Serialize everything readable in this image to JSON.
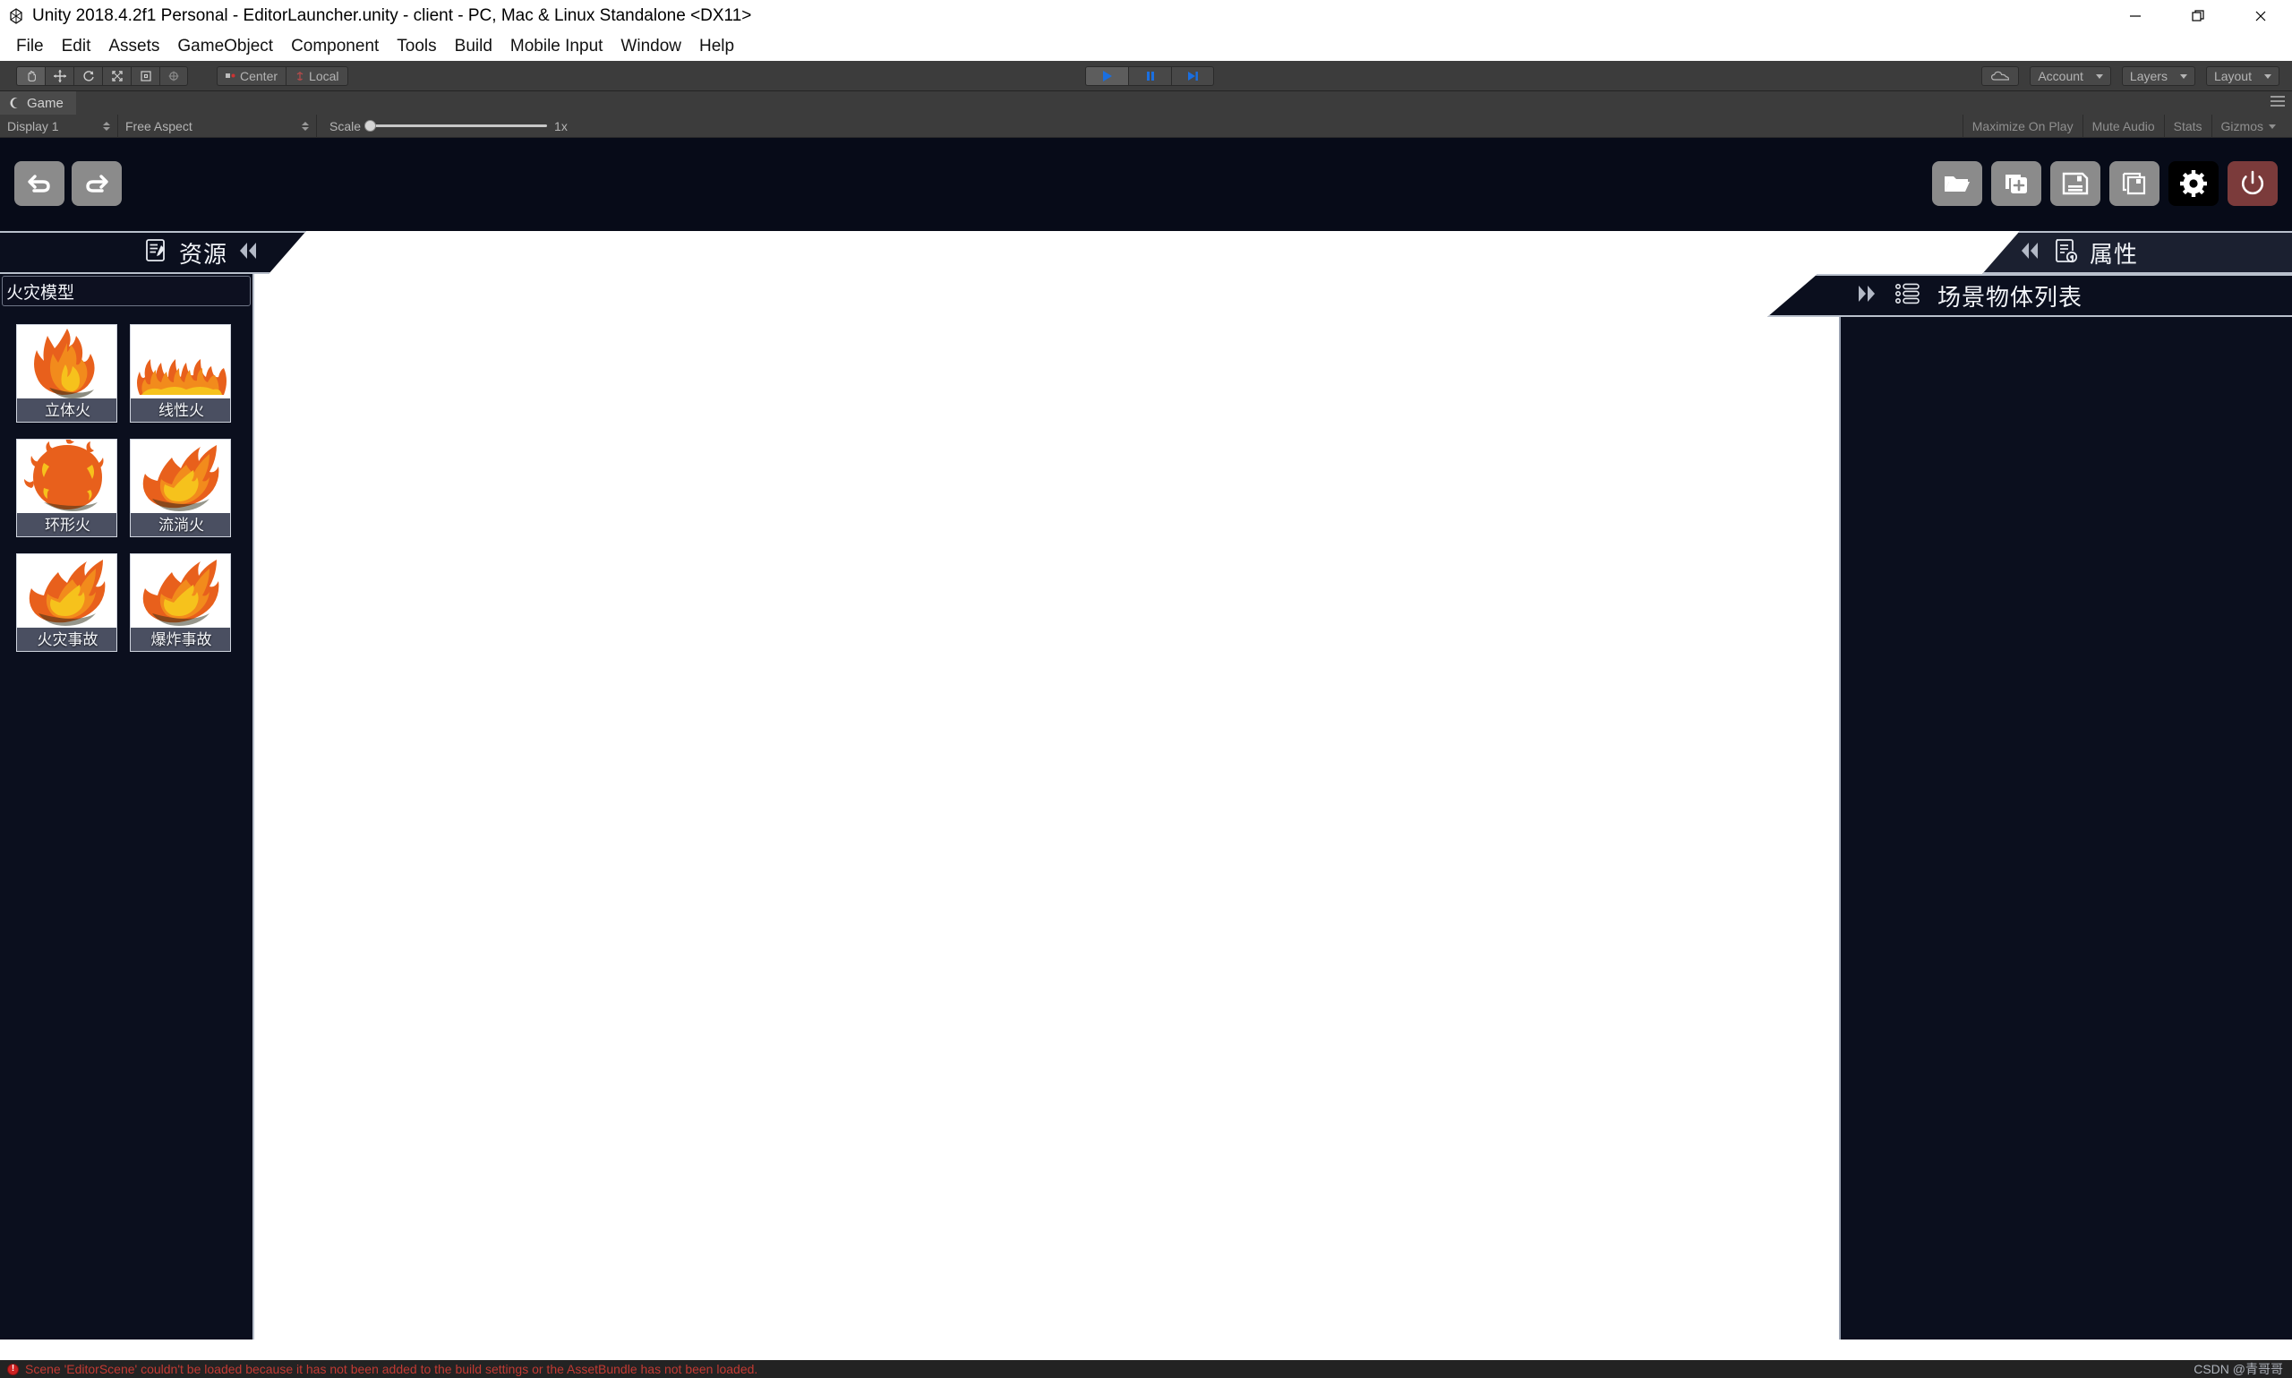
{
  "window": {
    "title": "Unity 2018.4.2f1 Personal - EditorLauncher.unity - client - PC, Mac & Linux Standalone <DX11>",
    "app_icon": "unity-icon",
    "minimize_label": "minimize-icon",
    "restore_label": "restore-icon",
    "close_label": "close-icon"
  },
  "menubar": {
    "items": [
      {
        "label": "File"
      },
      {
        "label": "Edit"
      },
      {
        "label": "Assets"
      },
      {
        "label": "GameObject"
      },
      {
        "label": "Component"
      },
      {
        "label": "Tools"
      },
      {
        "label": "Build"
      },
      {
        "label": "Mobile Input"
      },
      {
        "label": "Window"
      },
      {
        "label": "Help"
      }
    ]
  },
  "toolbar": {
    "tools": [
      {
        "icon": "hand-tool-icon",
        "active": true
      },
      {
        "icon": "move-tool-icon",
        "active": false
      },
      {
        "icon": "rotate-tool-icon",
        "active": false
      },
      {
        "icon": "scale-tool-icon",
        "active": false
      },
      {
        "icon": "rect-tool-icon",
        "active": false
      },
      {
        "icon": "transform-tool-icon",
        "active": false
      }
    ],
    "pivot_mode": "Center",
    "pivot_rotation": "Local",
    "play": "play-icon",
    "pause": "pause-icon",
    "step": "step-icon",
    "cloud": "cloud-icon",
    "account": "Account",
    "layers": "Layers",
    "layout": "Layout"
  },
  "gameview": {
    "tab_label": "Game",
    "display": "Display 1",
    "aspect": "Free Aspect",
    "scale_label": "Scale",
    "scale_value": "1x",
    "maximize_on_play": "Maximize On Play",
    "mute_audio": "Mute Audio",
    "stats": "Stats",
    "gizmos": "Gizmos"
  },
  "app": {
    "left_tools": [
      {
        "name": "undo-button",
        "icon": "undo-icon"
      },
      {
        "name": "redo-button",
        "icon": "redo-icon"
      }
    ],
    "right_tools": [
      {
        "name": "open-button",
        "icon": "folder-open-icon"
      },
      {
        "name": "new-button",
        "icon": "file-add-icon"
      },
      {
        "name": "save-button",
        "icon": "save-icon"
      },
      {
        "name": "save-as-button",
        "icon": "save-as-icon"
      },
      {
        "name": "settings-button",
        "icon": "gear-icon"
      },
      {
        "name": "exit-button",
        "icon": "power-icon"
      }
    ]
  },
  "resource_panel": {
    "title": "资源",
    "header_icon": "document-pencil-icon",
    "collapse_icon": "double-left-arrow-icon",
    "category": "火灾模型",
    "cards": [
      {
        "label": "立体火",
        "thumb": "fire-vertical-icon"
      },
      {
        "label": "线性火",
        "thumb": "fire-linear-icon"
      },
      {
        "label": "环形火",
        "thumb": "fire-ring-icon"
      },
      {
        "label": "流淌火",
        "thumb": "fire-flowing-icon"
      },
      {
        "label": "火灾事故",
        "thumb": "fire-accident-icon"
      },
      {
        "label": "爆炸事故",
        "thumb": "explosion-accident-icon"
      }
    ]
  },
  "property_panel": {
    "title": "属性",
    "header_icon": "document-gear-icon",
    "collapse_icon": "double-left-arrow-icon"
  },
  "scene_panel": {
    "title": "场景物体列表",
    "header_icon": "list-icon",
    "expand_icon": "double-right-arrow-icon"
  },
  "statusbar": {
    "error_icon": "error-icon",
    "message": "Scene 'EditorScene' couldn't be loaded because it has not been added to the build settings or the AssetBundle has not been loaded.",
    "watermark": "CSDN @青哥哥"
  },
  "colors": {
    "panel_bg": "#0b0f1e",
    "toolbar_bg": "#3c3c3c",
    "accent_blue": "#2f6fd6",
    "error_red": "#c33a33",
    "flame_orange": "#ef7920",
    "flame_red": "#e2521a",
    "flame_yellow": "#f5c518"
  }
}
